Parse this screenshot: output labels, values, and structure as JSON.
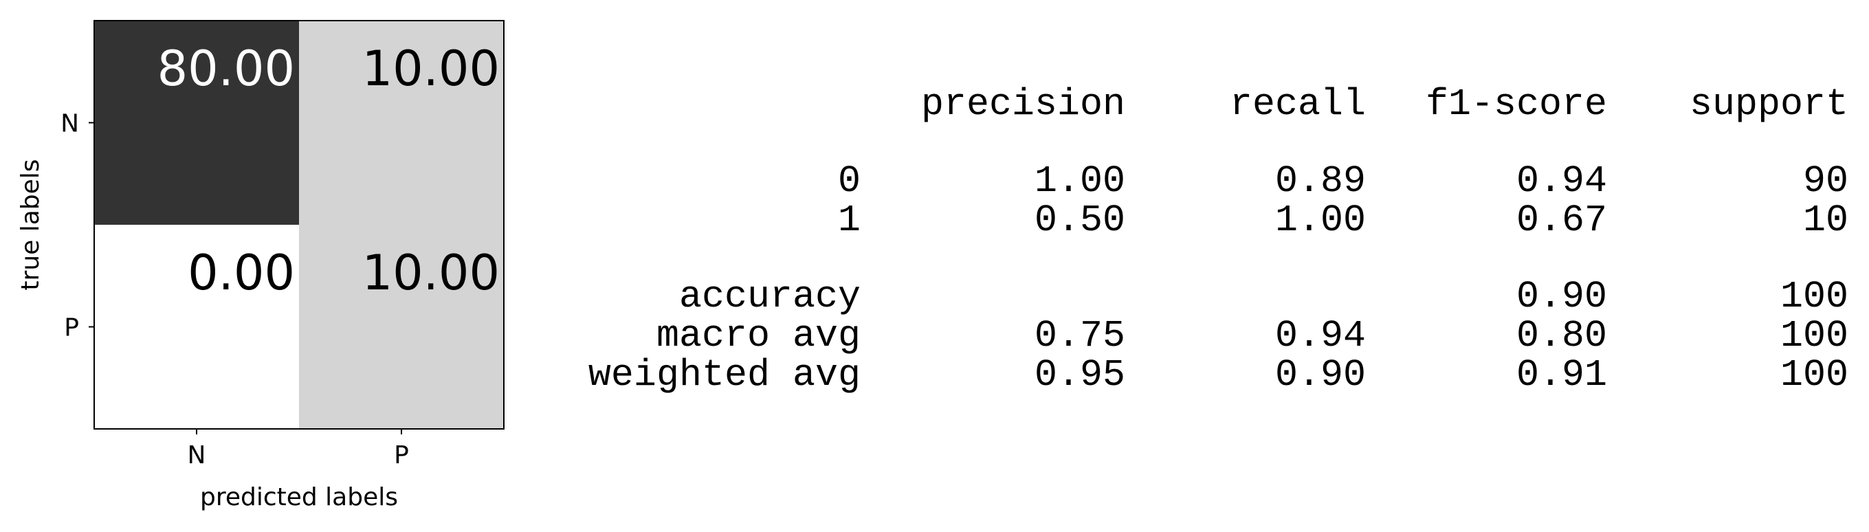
{
  "chart_data": [
    {
      "type": "heatmap",
      "xlabel": "predicted labels",
      "ylabel": "true labels",
      "x_categories": [
        "N",
        "P"
      ],
      "y_categories": [
        "N",
        "P"
      ],
      "values": [
        [
          80.0,
          10.0
        ],
        [
          0.0,
          10.0
        ]
      ],
      "cell_labels": [
        [
          "80.00",
          "10.00"
        ],
        [
          "0.00",
          "10.00"
        ]
      ],
      "colormap": "greys",
      "value_range": [
        0,
        80
      ],
      "colors": {
        "low": "#ffffff",
        "high": "#333333",
        "text_dark": "#000000",
        "text_light": "#ffffff"
      }
    },
    {
      "type": "table",
      "columns": [
        "precision",
        "recall",
        "f1-score",
        "support"
      ],
      "class_rows": [
        {
          "label": "0",
          "cells": [
            "1.00",
            "0.89",
            "0.94",
            "90"
          ]
        },
        {
          "label": "1",
          "cells": [
            "0.50",
            "1.00",
            "0.67",
            "10"
          ]
        }
      ],
      "summary_rows": [
        {
          "label": "accuracy",
          "cells": [
            "",
            "",
            "0.90",
            "100"
          ]
        },
        {
          "label": "macro avg",
          "cells": [
            "0.75",
            "0.94",
            "0.80",
            "100"
          ]
        },
        {
          "label": "weighted avg",
          "cells": [
            "0.95",
            "0.90",
            "0.91",
            "100"
          ]
        }
      ]
    }
  ]
}
